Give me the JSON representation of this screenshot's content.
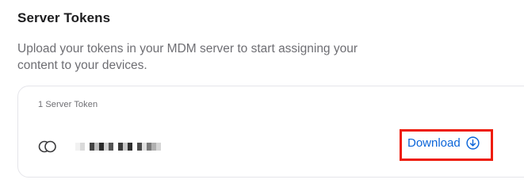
{
  "section": {
    "title": "Server Tokens",
    "description": "Upload your tokens in your MDM server to start assigning your content to your devices."
  },
  "card": {
    "header": "1 Server Token",
    "token": {
      "icon": "toggle-circles-icon",
      "name_redacted": true
    },
    "download": {
      "label": "Download",
      "icon": "download-circle-arrow-icon",
      "highlight_color": "#ee1c0b",
      "link_color": "#0a64d8"
    }
  }
}
